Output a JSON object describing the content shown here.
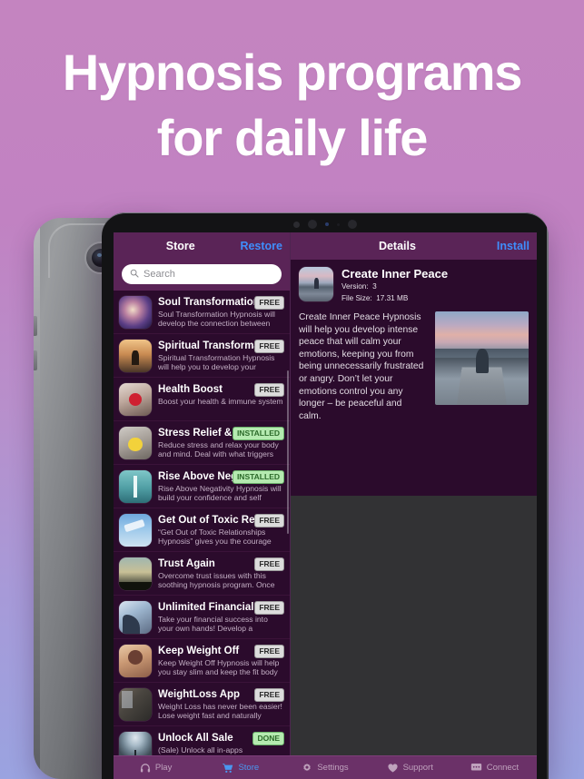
{
  "headline": {
    "line1": "Hypnosis programs",
    "line2": "for daily life"
  },
  "colors": {
    "bg_top": "#c484c0",
    "bg_bottom": "#9aa3e0",
    "nav_bar": "#5a2457",
    "list_bg": "#2b0b2c",
    "accent_link": "#3f8efc",
    "tab_active": "#4a97f0",
    "badge_free_bg": "#dcdcdc",
    "badge_installed_bg": "#b5eab0"
  },
  "store": {
    "nav": {
      "title": "Store",
      "restore_label": "Restore"
    },
    "search": {
      "placeholder": "Search",
      "value": "",
      "icon": "search-icon"
    },
    "items": [
      {
        "name": "Unlock All Sale",
        "desc": "(Sale) Unlock all in-apps permanently today",
        "badge": "DONE",
        "badge_type": "done",
        "art": "a-unlock"
      },
      {
        "name": "WeightLoss App",
        "desc": "Weight Loss has never been easier! Lose weight fast and naturally suppr…",
        "badge": "FREE",
        "badge_type": "free",
        "art": "a-weight"
      },
      {
        "name": "Keep Weight Off",
        "desc": "Keep Weight Off Hypnosis will help you stay slim and keep the fit body t…",
        "badge": "FREE",
        "badge_type": "free",
        "art": "a-keep"
      },
      {
        "name": "Unlimited Financial S",
        "desc": "Take your financial success into your own hands! Develop a motivated an…",
        "badge": "FREE",
        "badge_type": "free",
        "art": "a-financial"
      },
      {
        "name": "Trust Again",
        "desc": "Overcome trust issues with this soothing hypnosis program. Once tr…",
        "badge": "FREE",
        "badge_type": "free",
        "art": "a-trust"
      },
      {
        "name": "Get Out of Toxic Relat",
        "desc": "“Get Out of Toxic Relationships Hypnosis” gives you the courage an…",
        "badge": "FREE",
        "badge_type": "free",
        "art": "a-toxic"
      },
      {
        "name": "Rise Above Nega",
        "desc": "Rise Above Negativity Hypnosis will build your confidence and self estee…",
        "badge": "INSTALLED",
        "badge_type": "installed",
        "art": "a-rise"
      },
      {
        "name": "Stress Relief & An",
        "desc": "Reduce stress and relax your body and mind. Deal with what triggers yo…",
        "badge": "INSTALLED",
        "badge_type": "installed",
        "art": "a-stress"
      },
      {
        "name": "Health Boost",
        "desc": "Boost your health & immune system",
        "badge": "FREE",
        "badge_type": "free",
        "art": "a-health"
      },
      {
        "name": "Spiritual Transformati",
        "desc": "Spiritual Transformation Hypnosis will help you to develop your spiritual sid…",
        "badge": "FREE",
        "badge_type": "free",
        "art": "a-spiritual"
      },
      {
        "name": "Soul Transformation",
        "desc": "Soul Transformation Hypnosis will develop the connection between you…",
        "badge": "FREE",
        "badge_type": "free",
        "art": "a-soul"
      }
    ]
  },
  "details": {
    "nav": {
      "title": "Details",
      "action_label": "Install"
    },
    "app_title": "Create Inner Peace",
    "version_label": "Version:",
    "version_value": "3",
    "filesize_label": "File Size:",
    "filesize_value": "17.31 MB",
    "description": "Create Inner Peace Hypnosis will help you develop intense peace that will calm your emotions, keeping you from being unnecessarily frustrated or angry. Don’t let your emotions control you any longer – be peaceful and calm.",
    "screenshot_alt": "person meditating on a dock at sunset"
  },
  "tabbar": [
    {
      "label": "Play",
      "icon": "headphones-icon",
      "active": false
    },
    {
      "label": "Store",
      "icon": "cart-icon",
      "active": true
    },
    {
      "label": "Settings",
      "icon": "gear-icon",
      "active": false
    },
    {
      "label": "Support",
      "icon": "heart-icon",
      "active": false
    },
    {
      "label": "Connect",
      "icon": "chat-icon",
      "active": false
    }
  ]
}
